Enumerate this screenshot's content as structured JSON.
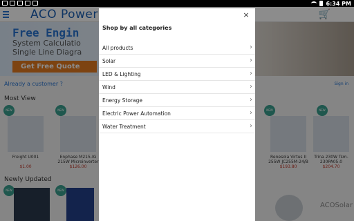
{
  "status_bar": {
    "time": "6:34 PM"
  },
  "app_bar": {
    "logo": "ACO Power"
  },
  "banner": {
    "title": "Free Engin",
    "subtitle_line1": "System Calculatio",
    "subtitle_line2": "Single Line Diagra",
    "button_label": "Get Free Quote"
  },
  "page": {
    "customer_link": "Already a customer ?",
    "sign_in": "Sign in",
    "most_view_title": "Most View",
    "newly_updated_title": "Newly Updated",
    "new_badge": "NEW",
    "most_view_products": [
      {
        "name": "Freight U001",
        "price": "$1.00"
      },
      {
        "name": "Enphase M215-IG 215W Microinverter",
        "price": "$126.00"
      },
      {
        "name": "Renesola Virtus II 255W JC255M-24/B",
        "price": "$193.80"
      },
      {
        "name": "Trina 230W Tsm-230PA05.0",
        "price": "$204.70"
      }
    ],
    "newly_updated_brand": "ACOSolar"
  },
  "dialog": {
    "title": "Shop by all categories",
    "close_glyph": "×",
    "chevron_glyph": "›",
    "categories": [
      "All products",
      "Solar",
      "LED & Lighting",
      "Wind",
      "Energy Storage",
      "Electric Power Automation",
      "Water Treatment"
    ]
  }
}
